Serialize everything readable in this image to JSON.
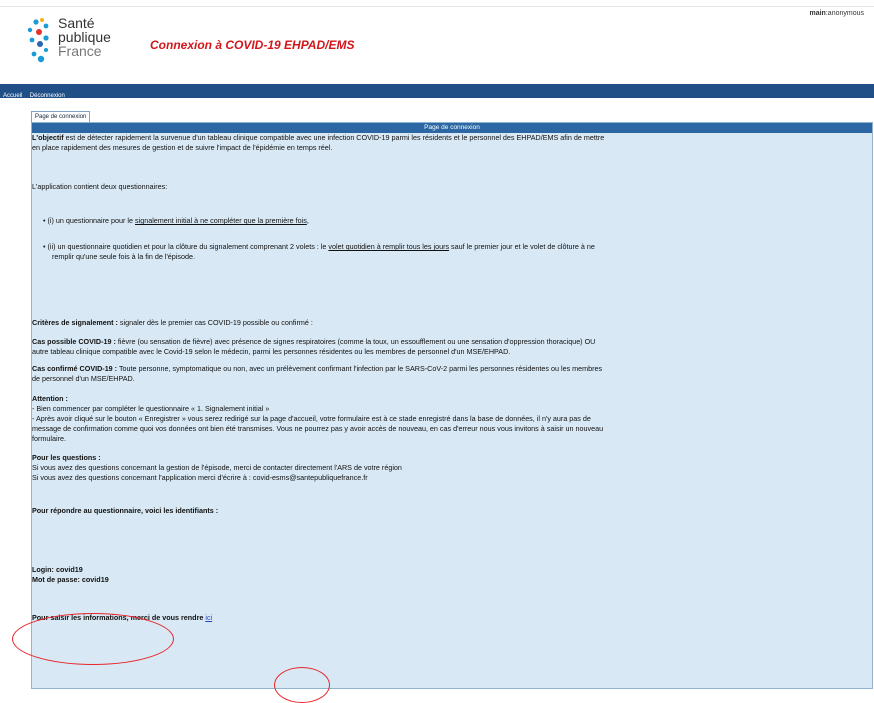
{
  "header": {
    "logo_lines": [
      "Santé",
      "publique",
      "France"
    ],
    "app_title": "Connexion à COVID-19 EHPAD/EMS",
    "user_label": "main",
    "user_value": "anonymous"
  },
  "nav": {
    "items": [
      "Accueil",
      "Déconnexion"
    ]
  },
  "tabs": [
    "Page de connexion"
  ],
  "panel_title": "Page de connexion",
  "content": {
    "objective_bold": "L'objectif",
    "objective_line1": " est de détecter rapidement la survenue d'un tableau clinique compatible avec une infection COVID-19 parmi les résidents et le personnel des EHPAD/EMS afin de mettre",
    "objective_line2": "en place rapidement des mesures de gestion et de suivre l'impact de l'épidémie en temps réel.",
    "contains": "L'application contient deux questionnaires:",
    "bullet1_prefix": "(i) un questionnaire pour le ",
    "bullet1_link": "signalement initial à ne compléter que la première fois",
    "bullet1_suffix": ",",
    "bullet2_line1_prefix": "(ii) un questionnaire quotidien et pour la clôture du signalement comprenant 2 volets : le ",
    "bullet2_line1_link": "volet quotidien à remplir tous les jours",
    "bullet2_line1_suffix": " sauf le premier jour et le volet de clôture à ne",
    "bullet2_line2": "remplir qu'une seule fois à la fin de l'épisode.",
    "criteria_bold": "Critères de signalement :",
    "criteria_text": " signaler dès le premier cas COVID-19 possible ou confirmé :",
    "possible_bold": "Cas possible COVID-19 :",
    "possible_line1": " fièvre (ou sensation de fièvre) avec présence de signes respiratoires (comme la toux, un essoufflement ou une sensation d'oppression thoracique) OU",
    "possible_line2": "autre tableau clinique compatible avec le Covid-19 selon le médecin, parmi les personnes résidentes ou les membres de personnel d'un MSE/EHPAD.",
    "confirmed_bold": "Cas confirmé COVID-19 :",
    "confirmed_line1": " Toute personne, symptomatique ou non, avec un prélèvement confirmant l'infection par le SARS-CoV-2 parmi les personnes résidentes ou les membres",
    "confirmed_line2": "de personnel d'un MSE/EHPAD.",
    "attention_title": "Attention :",
    "attention_line1": "- Bien commencer par compléter le questionnaire « 1. Signalement initial »",
    "attention_line2": "- Après avoir cliqué sur le bouton « Enregistrer » vous serez redirigé sur la page d'accueil, votre formulaire est à ce stade enregistré dans la base de données, il n'y aura pas de",
    "attention_line3": "message de confirmation comme quoi vos données ont bien été transmises. Vous ne pourrez pas y avoir accès de nouveau, en cas d'erreur nous vous invitons à saisir un nouveau",
    "attention_line4": "formulaire.",
    "questions_title": "Pour les questions :",
    "questions_line1": "Si vous avez des questions concernant la gestion de l'épisode, merci de contacter directement l'ARS de votre région",
    "questions_line2": "Si vous avez des questions concernant l'application merci d'écrire à : covid-esms@santepubliquefrance.fr",
    "identifiers_title": "Pour répondre au questionnaire, voici les identifiants :",
    "login_line": "Login: covid19",
    "password_line": "Mot de passe: covid19",
    "enter_text": "Pour saisir les informations, merci de vous rendre ",
    "enter_link": "ici"
  },
  "colors": {
    "nav_bg": "#1f4f86",
    "panel_bg": "#d8e9f5",
    "panel_header_bg": "#2d67a3",
    "title_red": "#d3161c",
    "annotation_red": "#e8262b"
  }
}
